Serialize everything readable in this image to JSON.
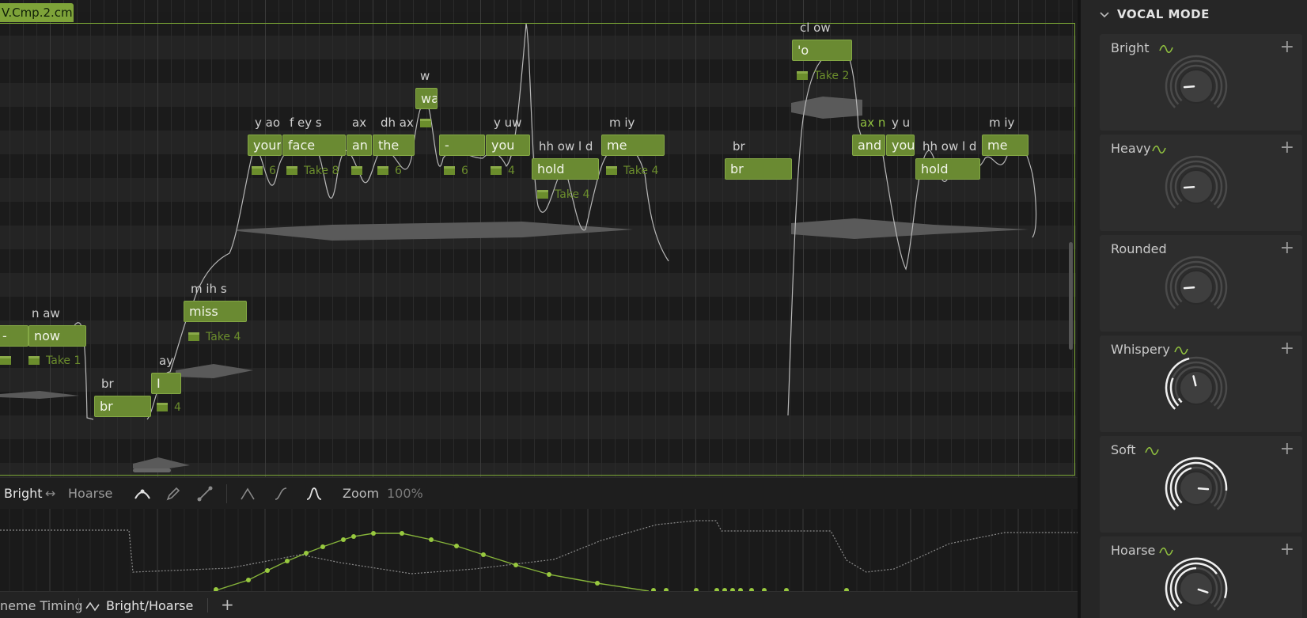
{
  "clip": {
    "name": "V.Cmp.2.cm"
  },
  "notes": [
    {
      "id": "n0",
      "text": "-"
    },
    {
      "id": "n1",
      "text": "now"
    },
    {
      "id": "n2",
      "text": "br"
    },
    {
      "id": "n3",
      "text": "I"
    },
    {
      "id": "n4",
      "text": "miss"
    },
    {
      "id": "n5",
      "text": "your"
    },
    {
      "id": "n6",
      "text": "face"
    },
    {
      "id": "n7",
      "text": "an"
    },
    {
      "id": "n8",
      "text": "the"
    },
    {
      "id": "n9",
      "text": "wa"
    },
    {
      "id": "n10",
      "text": "-"
    },
    {
      "id": "n11",
      "text": "you"
    },
    {
      "id": "n12",
      "text": "hold"
    },
    {
      "id": "n13",
      "text": "me"
    },
    {
      "id": "n14",
      "text": "br"
    },
    {
      "id": "n15",
      "text": "'o"
    },
    {
      "id": "n16",
      "text": "and"
    },
    {
      "id": "n17",
      "text": "you"
    },
    {
      "id": "n18",
      "text": "hold"
    },
    {
      "id": "n19",
      "text": "me"
    }
  ],
  "phonemes": [
    "n aw",
    "br",
    "ay",
    "m ih s",
    "y ao",
    "f ey s",
    "ax",
    "dh ax",
    "w",
    "y uw",
    "hh ow l d",
    "m iy",
    "br",
    "cl ow",
    "ax n",
    "y u",
    "hh ow l d",
    "m iy"
  ],
  "takes": [
    "Take 1",
    "4",
    "Take 4",
    "6",
    "Take 8",
    "6",
    "6",
    "4",
    "Take 4",
    "Take 4",
    "Take 2"
  ],
  "param_toolbar": {
    "left_label": "Bright",
    "arrow": "↔",
    "right_label": "Hoarse",
    "zoom_label": "Zoom",
    "zoom_value": "100%"
  },
  "bottom_tabs": {
    "tab1": "neme Timing",
    "tab2": "Bright/Hoarse",
    "add": "+"
  },
  "panel": {
    "title": "VOCAL MODE",
    "cards": [
      {
        "title": "Bright",
        "automation": true,
        "level": 0.15,
        "active": false
      },
      {
        "title": "Heavy",
        "automation": true,
        "level": 0.15,
        "active": false
      },
      {
        "title": "Rounded",
        "automation": false,
        "level": 0.15,
        "active": false
      },
      {
        "title": "Whispery",
        "automation": true,
        "level": 0.45,
        "active": true
      },
      {
        "title": "Soft",
        "automation": true,
        "level": 0.85,
        "active": true
      },
      {
        "title": "Hoarse",
        "automation": true,
        "level": 0.9,
        "active": true
      }
    ],
    "add_symbol": "+"
  },
  "colors": {
    "accent": "#7aa535",
    "note_fill": "#6a8a32",
    "take": "#6b8d2c",
    "phoneme_green": "#8fbf3f"
  }
}
